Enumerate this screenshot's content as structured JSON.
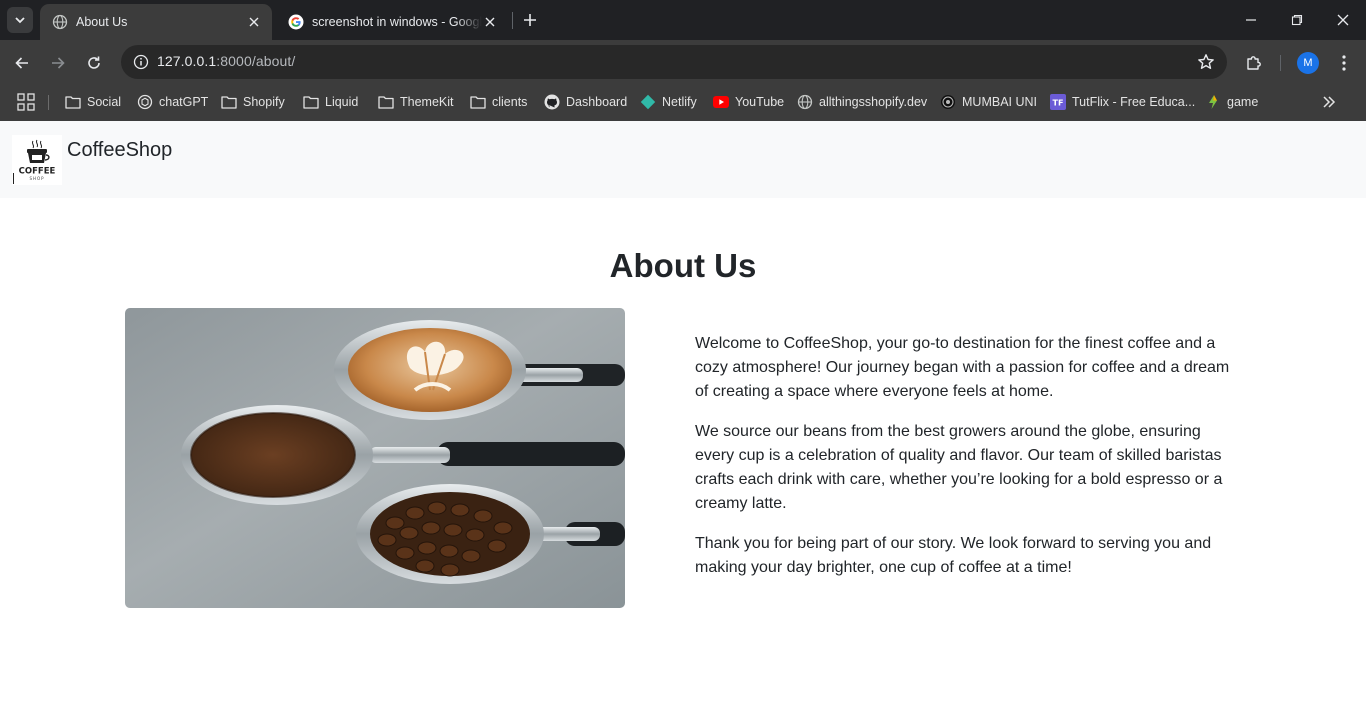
{
  "browser": {
    "tabs": [
      {
        "title": "About Us",
        "active": true
      },
      {
        "title": "screenshot in windows - Google Search",
        "active": false
      }
    ],
    "url_host": "127.0.0.1",
    "url_path": ":8000/about/",
    "profile_initial": "M",
    "bookmarks": [
      {
        "label": "Social",
        "icon": "folder-icon"
      },
      {
        "label": "chatGPT",
        "icon": "chatgpt-icon"
      },
      {
        "label": "Shopify",
        "icon": "folder-icon"
      },
      {
        "label": "Liquid",
        "icon": "folder-icon"
      },
      {
        "label": "ThemeKit",
        "icon": "folder-icon"
      },
      {
        "label": "clients",
        "icon": "folder-icon"
      },
      {
        "label": "Dashboard",
        "icon": "github-icon"
      },
      {
        "label": "Netlify",
        "icon": "netlify-icon"
      },
      {
        "label": "YouTube",
        "icon": "youtube-icon"
      },
      {
        "label": "allthingsshopify.dev",
        "icon": "globe-icon"
      },
      {
        "label": "MUMBAI UNI",
        "icon": "university-icon"
      },
      {
        "label": "TutFlix - Free Educa...",
        "icon": "tutflix-icon"
      },
      {
        "label": "game",
        "icon": "game-icon"
      }
    ]
  },
  "site": {
    "brand": "CoffeeShop",
    "logo_text": "COFFEE",
    "logo_subtext": "SHOP"
  },
  "about": {
    "title": "About Us",
    "paragraphs": [
      "Welcome to CoffeeShop, your go-to destination for the finest coffee and a cozy atmosphere! Our journey began with a passion for coffee and a dream of creating a space where everyone feels at home.",
      "We source our beans from the best growers around the globe, ensuring every cup is a celebration of quality and flavor. Our team of skilled baristas crafts each drink with care, whether you’re looking for a bold espresso or a creamy latte.",
      "Thank you for being part of our story. We look forward to serving you and making your day brighter, one cup of coffee at a time!"
    ]
  },
  "colors": {
    "chrome_dark": "#202124",
    "chrome_toolbar": "#3c3c3c",
    "navbar_bg": "#f8f9fa",
    "text": "#212529",
    "avatar": "#1a73e8"
  }
}
